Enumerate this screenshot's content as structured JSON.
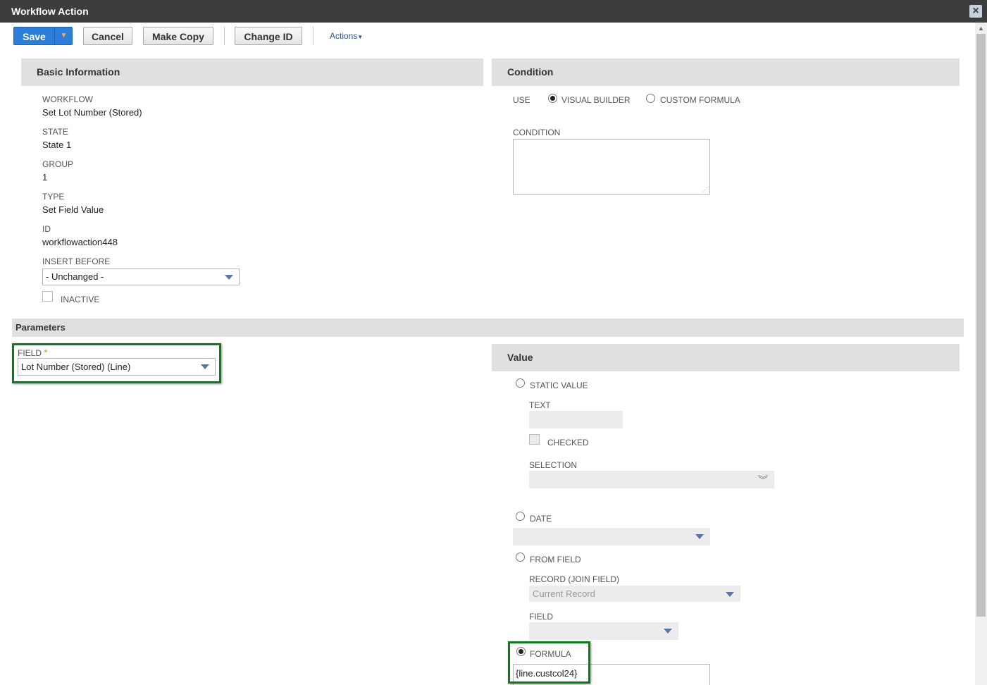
{
  "window": {
    "title": "Workflow Action",
    "close_icon": "close-icon"
  },
  "toolbar": {
    "save": "Save",
    "cancel": "Cancel",
    "make_copy": "Make Copy",
    "change_id": "Change ID",
    "actions": "Actions"
  },
  "basic": {
    "header": "Basic Information",
    "workflow_label": "WORKFLOW",
    "workflow_value": "Set Lot Number (Stored)",
    "state_label": "STATE",
    "state_value": "State 1",
    "group_label": "GROUP",
    "group_value": "1",
    "type_label": "TYPE",
    "type_value": "Set Field Value",
    "id_label": "ID",
    "id_value": "workflowaction448",
    "insert_before_label": "INSERT BEFORE",
    "insert_before_value": "- Unchanged -",
    "inactive_label": "INACTIVE"
  },
  "condition": {
    "header": "Condition",
    "use_label": "USE",
    "visual_builder": "VISUAL BUILDER",
    "custom_formula": "CUSTOM FORMULA",
    "condition_label": "CONDITION"
  },
  "parameters": {
    "header": "Parameters",
    "field_label": "FIELD",
    "required_mark": "*",
    "field_value": "Lot Number (Stored) (Line)"
  },
  "value": {
    "header": "Value",
    "static_value": "STATIC VALUE",
    "text_label": "TEXT",
    "checked_label": "CHECKED",
    "selection_label": "SELECTION",
    "date_label": "DATE",
    "from_field": "FROM FIELD",
    "record_label": "RECORD (JOIN FIELD)",
    "record_placeholder": "Current Record",
    "field_label": "FIELD",
    "formula_label": "FORMULA",
    "formula_value": "{line.custcol24}"
  },
  "colors": {
    "save_blue": "#2d7ed8",
    "highlight_green": "#0f7a1a",
    "titlebar": "#3d3d3d"
  }
}
